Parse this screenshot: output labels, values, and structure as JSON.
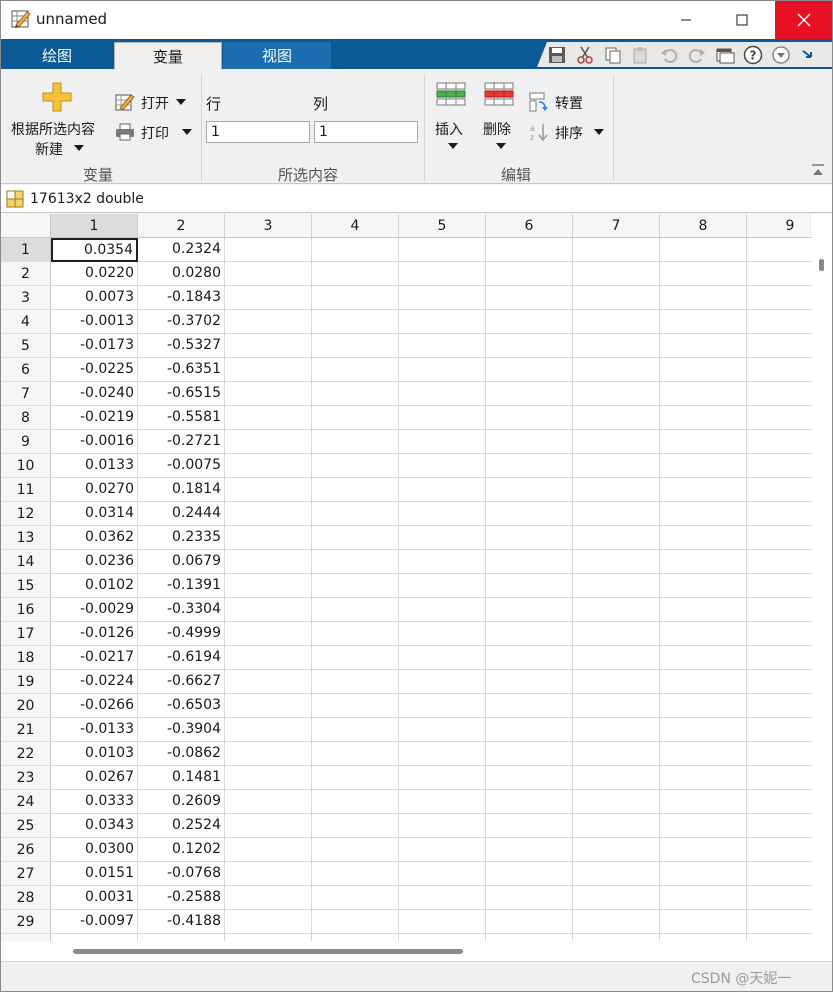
{
  "window": {
    "title": "unnamed"
  },
  "tabs": [
    {
      "label": "绘图",
      "active": false
    },
    {
      "label": "变量",
      "active": true
    },
    {
      "label": "视图",
      "active": false
    }
  ],
  "ribbon": {
    "variable_group": {
      "label": "变量",
      "new_from_selection_line1": "根据所选内容",
      "new_from_selection_line2": "新建",
      "open_label": "打开",
      "print_label": "打印"
    },
    "selection_group": {
      "label": "所选内容",
      "row_label": "行",
      "col_label": "列",
      "row_value": "1",
      "col_value": "1"
    },
    "edit_group": {
      "label": "编辑",
      "insert_label": "插入",
      "delete_label": "删除",
      "transpose_label": "转置",
      "sort_label": "排序"
    }
  },
  "variable_info": "17613x2 double",
  "grid": {
    "columns": [
      "1",
      "2",
      "3",
      "4",
      "5",
      "6",
      "7",
      "8",
      "9"
    ],
    "active_row": 1,
    "active_col": 1,
    "rows": [
      {
        "index": "1",
        "values": [
          "0.0354",
          "0.2324"
        ]
      },
      {
        "index": "2",
        "values": [
          "0.0220",
          "0.0280"
        ]
      },
      {
        "index": "3",
        "values": [
          "0.0073",
          "-0.1843"
        ]
      },
      {
        "index": "4",
        "values": [
          "-0.0013",
          "-0.3702"
        ]
      },
      {
        "index": "5",
        "values": [
          "-0.0173",
          "-0.5327"
        ]
      },
      {
        "index": "6",
        "values": [
          "-0.0225",
          "-0.6351"
        ]
      },
      {
        "index": "7",
        "values": [
          "-0.0240",
          "-0.6515"
        ]
      },
      {
        "index": "8",
        "values": [
          "-0.0219",
          "-0.5581"
        ]
      },
      {
        "index": "9",
        "values": [
          "-0.0016",
          "-0.2721"
        ]
      },
      {
        "index": "10",
        "values": [
          "0.0133",
          "-0.0075"
        ]
      },
      {
        "index": "11",
        "values": [
          "0.0270",
          "0.1814"
        ]
      },
      {
        "index": "12",
        "values": [
          "0.0314",
          "0.2444"
        ]
      },
      {
        "index": "13",
        "values": [
          "0.0362",
          "0.2335"
        ]
      },
      {
        "index": "14",
        "values": [
          "0.0236",
          "0.0679"
        ]
      },
      {
        "index": "15",
        "values": [
          "0.0102",
          "-0.1391"
        ]
      },
      {
        "index": "16",
        "values": [
          "-0.0029",
          "-0.3304"
        ]
      },
      {
        "index": "17",
        "values": [
          "-0.0126",
          "-0.4999"
        ]
      },
      {
        "index": "18",
        "values": [
          "-0.0217",
          "-0.6194"
        ]
      },
      {
        "index": "19",
        "values": [
          "-0.0224",
          "-0.6627"
        ]
      },
      {
        "index": "20",
        "values": [
          "-0.0266",
          "-0.6503"
        ]
      },
      {
        "index": "21",
        "values": [
          "-0.0133",
          "-0.3904"
        ]
      },
      {
        "index": "22",
        "values": [
          "0.0103",
          "-0.0862"
        ]
      },
      {
        "index": "23",
        "values": [
          "0.0267",
          "0.1481"
        ]
      },
      {
        "index": "24",
        "values": [
          "0.0333",
          "0.2609"
        ]
      },
      {
        "index": "25",
        "values": [
          "0.0343",
          "0.2524"
        ]
      },
      {
        "index": "26",
        "values": [
          "0.0300",
          "0.1202"
        ]
      },
      {
        "index": "27",
        "values": [
          "0.0151",
          "-0.0768"
        ]
      },
      {
        "index": "28",
        "values": [
          "0.0031",
          "-0.2588"
        ]
      },
      {
        "index": "29",
        "values": [
          "-0.0097",
          "-0.4188"
        ]
      }
    ]
  },
  "status": {
    "watermark": "CSDN @天妮一"
  },
  "icons": {
    "app": "variable-editor-icon",
    "quick_access": [
      "save-icon",
      "cut-icon",
      "copy-icon",
      "paste-icon",
      "undo-icon",
      "redo-icon",
      "window-icon",
      "help-icon",
      "more-options-icon",
      "collapse-arrow-icon"
    ]
  }
}
